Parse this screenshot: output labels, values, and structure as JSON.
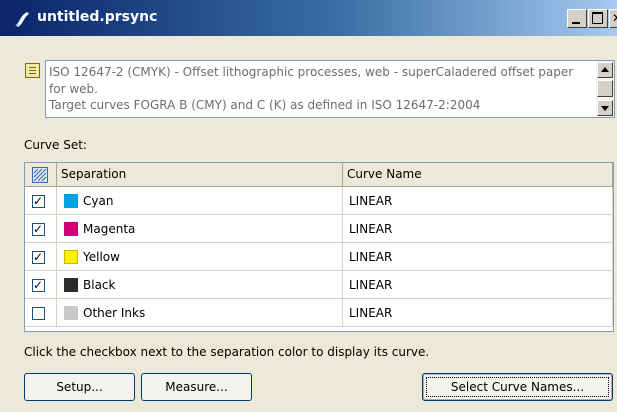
{
  "window": {
    "title": "untitled.prsync",
    "controls": [
      "minimize",
      "maximize",
      "close"
    ]
  },
  "description": {
    "icon": "note-icon",
    "text": "ISO 12647-2 (CMYK) - Offset lithographic processes, web - superCaladered offset paper for web.\nTarget curves FOGRA B (CMY) and C (K) as defined in ISO 12647-2:2004"
  },
  "curve_set": {
    "label": "Curve Set:",
    "columns": {
      "select_all_icon": "select-all-icon",
      "separation": "Separation",
      "curve_name": "Curve Name"
    },
    "rows": [
      {
        "checked": true,
        "separation": "Cyan",
        "color": "#00a0e4",
        "curve": "LINEAR"
      },
      {
        "checked": true,
        "separation": "Magenta",
        "color": "#d0007a",
        "curve": "LINEAR"
      },
      {
        "checked": true,
        "separation": "Yellow",
        "color": "#ffef00",
        "curve": "LINEAR"
      },
      {
        "checked": true,
        "separation": "Black",
        "color": "#2b2b2b",
        "curve": "LINEAR"
      },
      {
        "checked": false,
        "separation": "Other Inks",
        "color": "#c8c8c8",
        "curve": "LINEAR"
      }
    ]
  },
  "hint": "Click the checkbox next to the separation color to display its curve.",
  "buttons": {
    "setup": "Setup...",
    "measure": "Measure...",
    "select_curve_names": "Select Curve Names..."
  }
}
